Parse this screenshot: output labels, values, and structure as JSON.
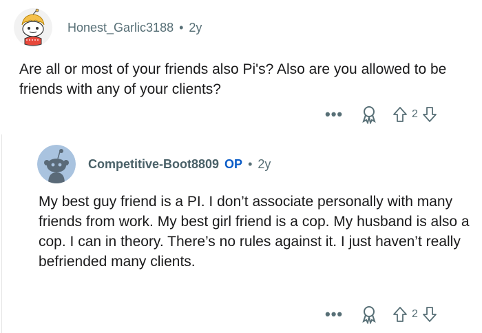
{
  "comments": [
    {
      "username": "Honest_Garlic3188",
      "separator": "•",
      "age": "2y",
      "text": "Are all or most of your friends also Pi's? Also are you allowed to be friends with any of your clients?",
      "more": "•••",
      "vote_count": "2",
      "avatar_icon": "snoo-avatar-icon"
    },
    {
      "username": "Competitive-Boot8809",
      "op_badge": "OP",
      "separator": "•",
      "age": "2y",
      "text": "My best guy friend is a PI. I don’t associate personally with many friends from work. My best girl friend is a cop. My husband is also a cop. I can in theory. There’s no rules against it. I just haven’t really befriended many clients.",
      "more": "•••",
      "vote_count": "2",
      "avatar_icon": "default-snoo-avatar-icon"
    }
  ],
  "colors": {
    "meta": "#576f76",
    "op": "#0a5cc7",
    "text": "#1a1a1b",
    "thread_line": "#e5e5e5"
  }
}
